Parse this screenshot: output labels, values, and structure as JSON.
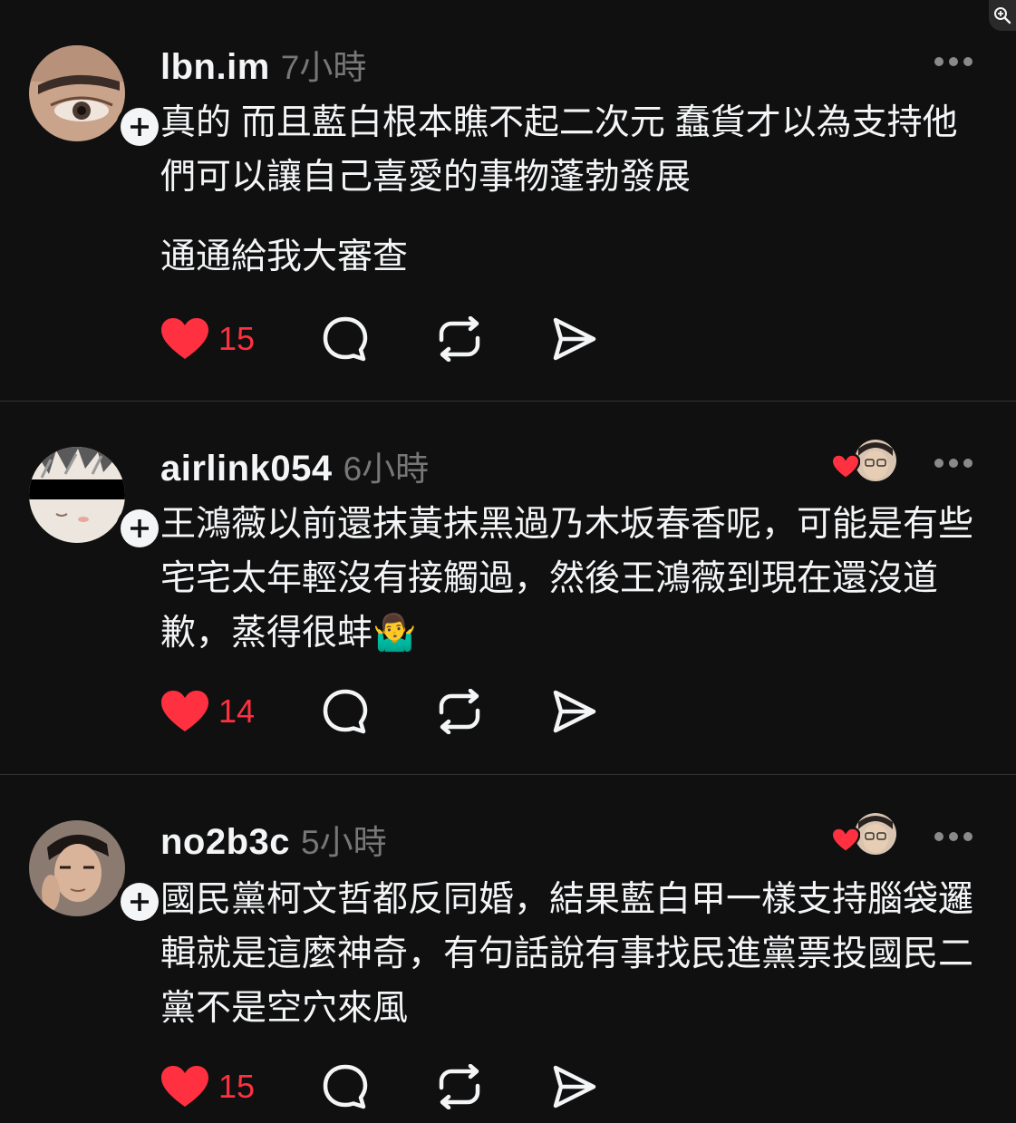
{
  "posts": [
    {
      "username": "lbn.im",
      "time": "7小時",
      "paragraphs": [
        "真的 而且藍白根本瞧不起二次元 蠢貨才以為支持他們可以讓自己喜愛的事物蓬勃發展",
        "通通給我大審查"
      ],
      "likes": "15",
      "has_liker": false
    },
    {
      "username": "airlink054",
      "time": "6小時",
      "paragraphs": [
        "王鴻薇以前還抹黃抹黑過乃木坂春香呢，可能是有些宅宅太年輕沒有接觸過，然後王鴻薇到現在還沒道歉，蒸得很蚌🤷‍♂️"
      ],
      "likes": "14",
      "has_liker": true
    },
    {
      "username": "no2b3c",
      "time": "5小時",
      "paragraphs": [
        "國民黨柯文哲都反同婚，結果藍白甲一樣支持腦袋邏輯就是這麼神奇，有句話說有事找民進黨票投國民二黨不是空穴來風"
      ],
      "likes": "15",
      "has_liker": true
    }
  ],
  "colors": {
    "background": "#101010",
    "like_red": "#ff3040",
    "text": "#f3f5f7",
    "muted": "#777777"
  },
  "icons": [
    "zoom-in-icon",
    "plus-icon",
    "more-icon",
    "heart-icon",
    "comment-icon",
    "repost-icon",
    "share-icon"
  ]
}
